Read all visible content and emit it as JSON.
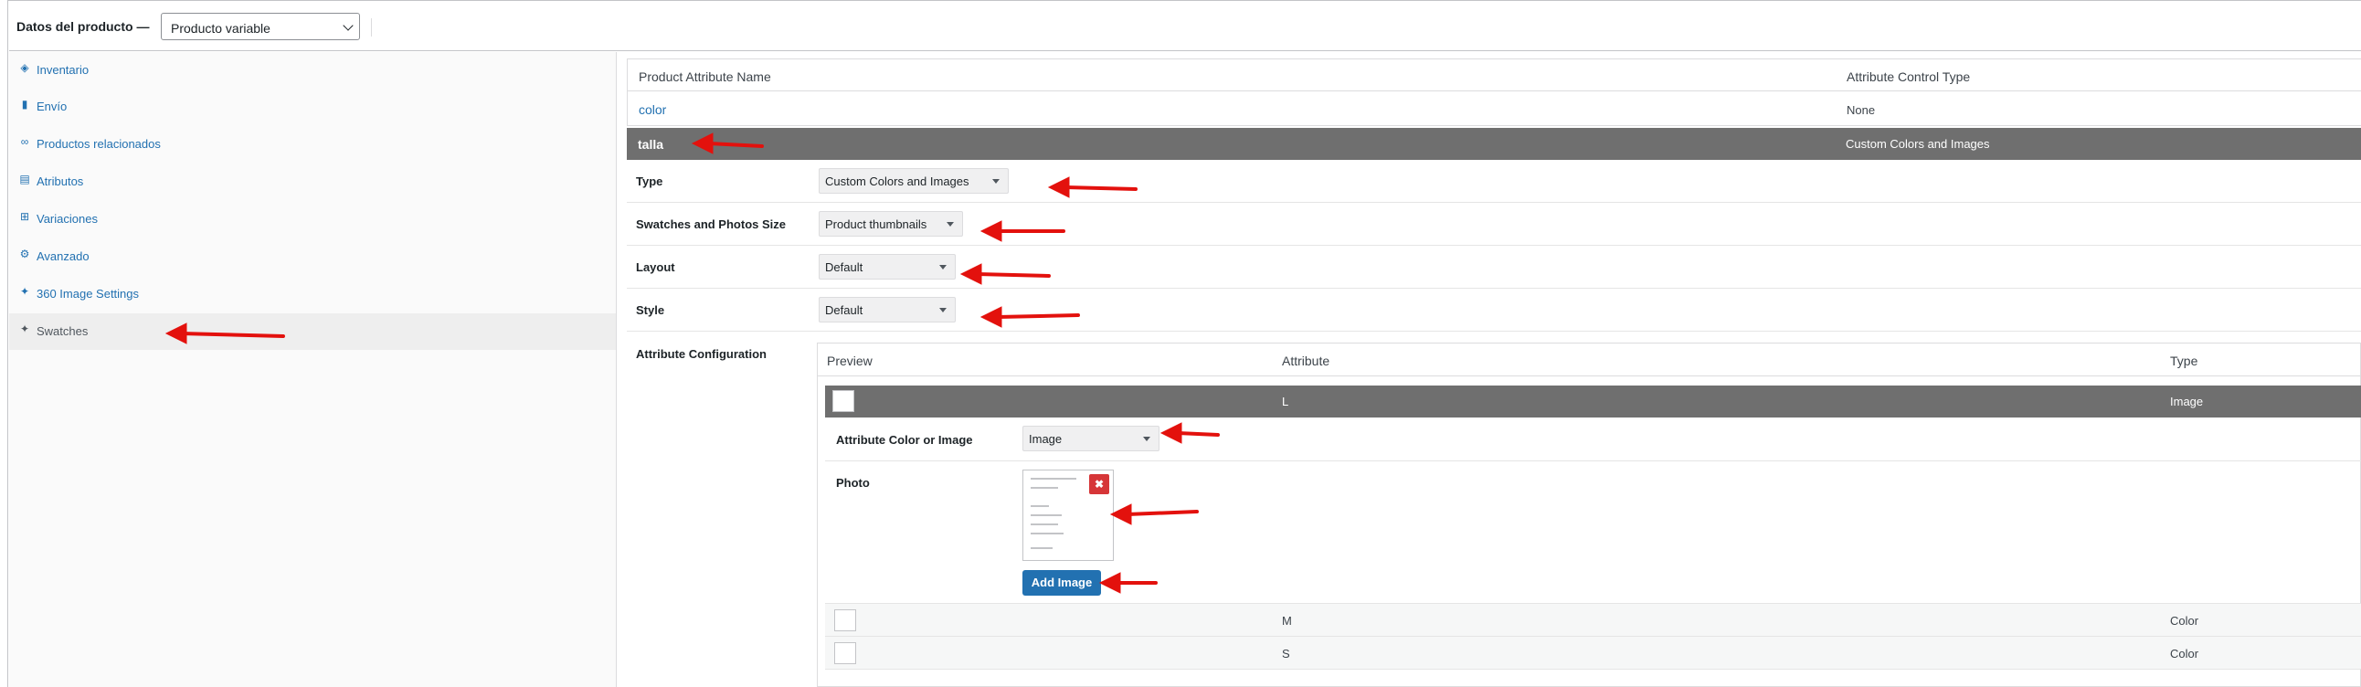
{
  "header": {
    "label": "Datos del producto —",
    "product_type": "Producto variable"
  },
  "sidebar": {
    "items": [
      {
        "label": "Inventario",
        "icon": "tag-icon"
      },
      {
        "label": "Envío",
        "icon": "truck-icon"
      },
      {
        "label": "Productos relacionados",
        "icon": "link-icon"
      },
      {
        "label": "Atributos",
        "icon": "list-icon"
      },
      {
        "label": "Variaciones",
        "icon": "grid-icon"
      },
      {
        "label": "Avanzado",
        "icon": "gear-icon"
      },
      {
        "label": "360 Image Settings",
        "icon": "wrench-icon"
      },
      {
        "label": "Swatches",
        "icon": "wrench-icon"
      }
    ]
  },
  "attributes": {
    "header": {
      "name": "Product Attribute Name",
      "control_type": "Attribute Control Type"
    },
    "rows": [
      {
        "name": "color",
        "type": "None"
      },
      {
        "name": "talla",
        "type": "Custom Colors and Images"
      }
    ]
  },
  "form": {
    "type": {
      "label": "Type",
      "value": "Custom Colors and Images"
    },
    "size": {
      "label": "Swatches and Photos Size",
      "value": "Product thumbnails"
    },
    "layout": {
      "label": "Layout",
      "value": "Default"
    },
    "style": {
      "label": "Style",
      "value": "Default"
    },
    "config_label": "Attribute Configuration"
  },
  "config": {
    "header": {
      "preview": "Preview",
      "attribute": "Attribute",
      "type": "Type"
    },
    "expanded": {
      "attribute": "L",
      "type": "Image",
      "color_or_image_label": "Attribute Color or Image",
      "color_or_image_value": "Image",
      "photo_label": "Photo",
      "add_image": "Add Image"
    },
    "rows": [
      {
        "attribute": "M",
        "type": "Color"
      },
      {
        "attribute": "S",
        "type": "Color"
      }
    ]
  },
  "colors": {
    "link": "#2271b1",
    "selected_row": "#6f6f6f",
    "arrow": "#e3110d",
    "button": "#2271b1"
  }
}
